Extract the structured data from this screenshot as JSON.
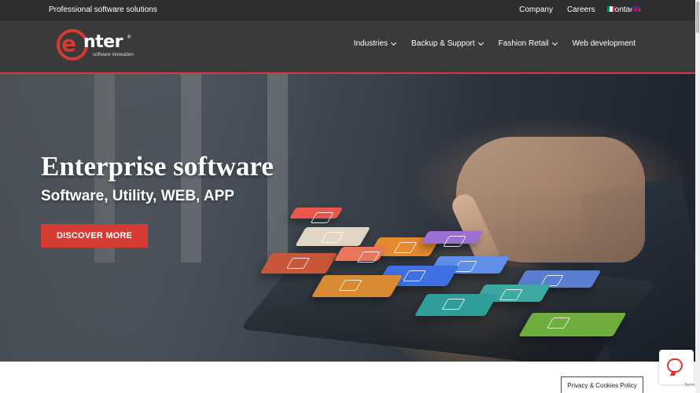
{
  "topbar": {
    "tagline": "Professional software solutions",
    "links": [
      {
        "label": "Company"
      },
      {
        "label": "Careers"
      },
      {
        "label": "Contacts"
      }
    ],
    "languages": [
      "italian-flag-icon",
      "english-flag-icon"
    ]
  },
  "logo": {
    "letter": "e",
    "word": "nter",
    "subtitle": "software innovation",
    "registered": "®"
  },
  "nav": {
    "items": [
      {
        "label": "Industries",
        "has_dropdown": true
      },
      {
        "label": "Backup & Support",
        "has_dropdown": true
      },
      {
        "label": "Fashion Retail",
        "has_dropdown": true
      },
      {
        "label": "Web development",
        "has_dropdown": false
      }
    ]
  },
  "hero": {
    "title": "Enterprise software",
    "subtitle": "Software, Utility, WEB, APP",
    "cta_label": "DISCOVER MORE"
  },
  "footer_widgets": {
    "privacy_label": "Privacy & Cookies Policy",
    "chat_icon": "chat-bubble-icon",
    "chat_caption": "- Terms"
  },
  "colors": {
    "accent": "#d63a34",
    "topbar": "#2e2e2e",
    "header": "#3a3a3a"
  }
}
